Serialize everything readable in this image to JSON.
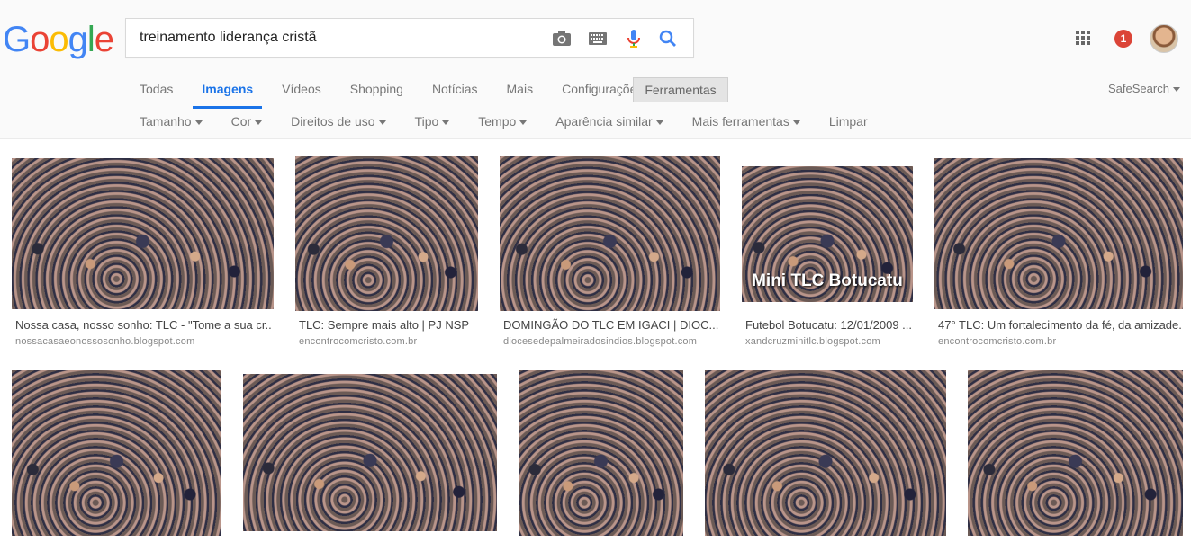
{
  "search": {
    "query": "treinamento liderança cristã"
  },
  "logo": {
    "text": "Google"
  },
  "tabs": [
    {
      "label": "Todas",
      "active": false
    },
    {
      "label": "Imagens",
      "active": true
    },
    {
      "label": "Vídeos",
      "active": false
    },
    {
      "label": "Shopping",
      "active": false
    },
    {
      "label": "Notícias",
      "active": false
    },
    {
      "label": "Mais",
      "active": false
    },
    {
      "label": "Configurações",
      "active": false
    }
  ],
  "tools_button": "Ferramentas",
  "safesearch": "SafeSearch",
  "notifications": {
    "count": "1"
  },
  "tools": [
    {
      "label": "Tamanho",
      "caret": true
    },
    {
      "label": "Cor",
      "caret": true
    },
    {
      "label": "Direitos de uso",
      "caret": true
    },
    {
      "label": "Tipo",
      "caret": true
    },
    {
      "label": "Tempo",
      "caret": true
    },
    {
      "label": "Aparência similar",
      "caret": true
    },
    {
      "label": "Mais ferramentas",
      "caret": true
    },
    {
      "label": "Limpar",
      "caret": false
    }
  ],
  "results": [
    {
      "caption": "Nossa casa, nosso sonho: TLC - \"Tome a sua cr...",
      "source": "nossacasaeonossosonho.blogspot.com"
    },
    {
      "caption": "TLC: Sempre mais alto | PJ NSP",
      "source": "encontrocomcristo.com.br"
    },
    {
      "caption": "DOMINGÃO DO TLC EM IGACI | DIOC...",
      "source": "diocesedepalmeiradosindios.blogspot.com"
    },
    {
      "caption": "Futebol Botucatu: 12/01/2009 ...",
      "source": "xandcruzminitlc.blogspot.com",
      "overlay": "Mini TLC Botucatu"
    },
    {
      "caption": "47° TLC: Um fortalecimento da fé, da amizade...",
      "source": "encontrocomcristo.com.br"
    }
  ],
  "colors": {
    "accent": "#1a73e8",
    "notif": "#db4437"
  }
}
